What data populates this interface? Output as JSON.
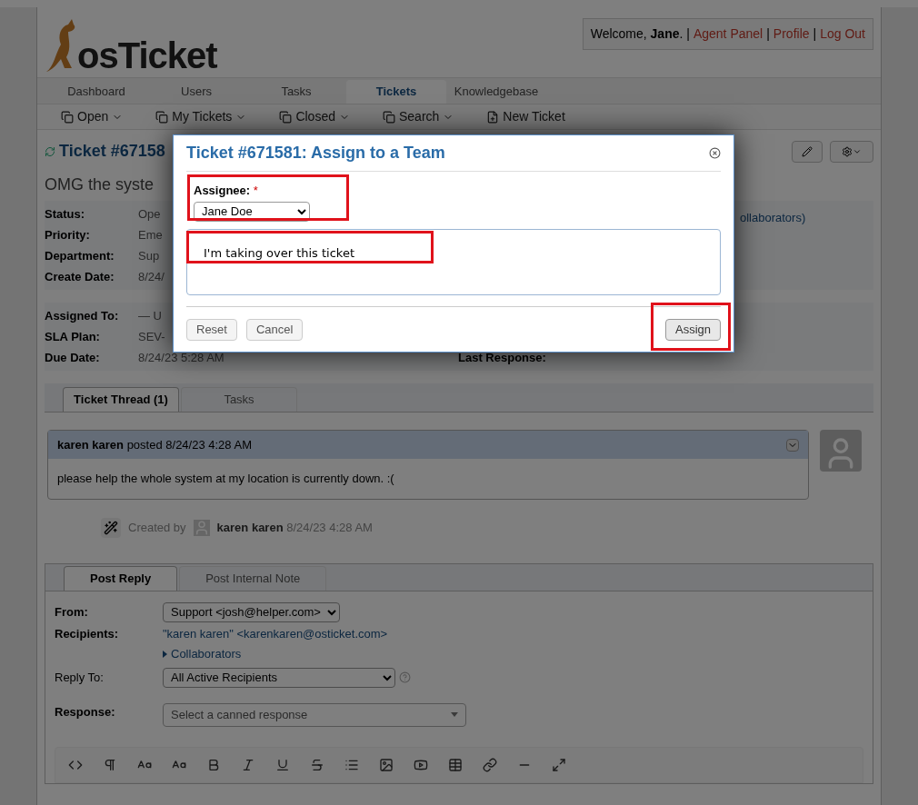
{
  "header": {
    "logo": "osTicket",
    "welcome_prefix": "Welcome, ",
    "user": "Jane",
    "welcome_suffix": ". |",
    "links": [
      {
        "label": "Agent Panel"
      },
      {
        "label": "Profile"
      },
      {
        "label": "Log Out"
      }
    ],
    "separator": "|"
  },
  "nav": [
    {
      "label": "Dashboard",
      "selected": false
    },
    {
      "label": "Users",
      "selected": false
    },
    {
      "label": "Tasks",
      "selected": false
    },
    {
      "label": "Tickets",
      "selected": true
    },
    {
      "label": "Knowledgebase",
      "selected": false
    }
  ],
  "subnav": [
    {
      "label": "Open",
      "kind": "menu"
    },
    {
      "label": "My Tickets",
      "kind": "menu"
    },
    {
      "label": "Closed",
      "kind": "menu"
    },
    {
      "label": "Search",
      "kind": "menu"
    },
    {
      "label": "New Ticket",
      "kind": "new"
    }
  ],
  "ticket": {
    "title": "Ticket #67158",
    "subject": "OMG the syste",
    "fields": [
      {
        "label": "Status:",
        "value": "Ope"
      },
      {
        "label": "Priority:",
        "value": "Eme"
      },
      {
        "label": "Department:",
        "value": "Sup"
      },
      {
        "label": "Create Date:",
        "value": "8/24/"
      }
    ],
    "fields2": [
      {
        "label": "Assigned To:",
        "value": "— U"
      },
      {
        "label": "SLA Plan:",
        "value": "SEV-"
      },
      {
        "label": "Due Date:",
        "value": "8/24/23 5:28 AM"
      }
    ],
    "right_text": "ollaborators)",
    "right_label": "Last Response:"
  },
  "thread_tabs": [
    {
      "label": "Ticket Thread (1)",
      "selected": true
    },
    {
      "label": "Tasks",
      "selected": false
    }
  ],
  "post": {
    "author": "karen karen",
    "verb": "posted",
    "time": "8/24/23 4:28 AM",
    "body": "please help the whole system at my location is currently down. :("
  },
  "event": {
    "prefix": "Created by",
    "author": "karen karen",
    "time": "8/24/23 4:28 AM"
  },
  "reply_tabs": [
    {
      "label": "Post Reply",
      "selected": true
    },
    {
      "label": "Post Internal Note",
      "selected": false
    }
  ],
  "reply": {
    "from_label": "From:",
    "from_value": "Support <josh@helper.com>",
    "recipients_label": "Recipients:",
    "recipients": "\"karen karen\" <karenkaren@osticket.com>",
    "collaborators": "Collaborators",
    "reply_to_label": "Reply To:",
    "reply_to_value": "All Active Recipients",
    "response_label": "Response:",
    "response_placeholder": "Select a canned response"
  },
  "modal": {
    "title": "Ticket #671581: Assign to a Team",
    "assignee_label": "Assignee:",
    "required_mark": "*",
    "assignee": "Jane Doe",
    "comment": "I'm taking over this ticket",
    "buttons": [
      "Reset",
      "Cancel"
    ],
    "submit": "Assign"
  }
}
